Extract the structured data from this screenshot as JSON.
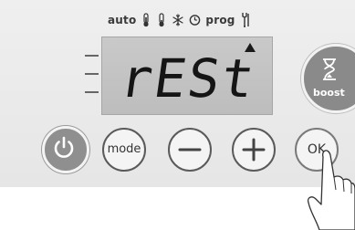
{
  "modes": {
    "auto_label": "auto",
    "prog_label": "prog",
    "icons": [
      "thermometer-comfort-icon",
      "thermometer-eco-icon",
      "snowflake-icon",
      "clock-icon",
      "wrench-icon"
    ]
  },
  "display": {
    "text": "rESt",
    "indicator": "triangle-up-icon",
    "level_bars": 3
  },
  "buttons": {
    "power_icon": "power-icon",
    "mode_label": "mode",
    "minus_icon": "minus-icon",
    "plus_icon": "plus-icon",
    "ok_label": "OK",
    "boost_label": "boost",
    "boost_icon": "hourglass-icon"
  },
  "colors": {
    "panel": "#e6e6e6",
    "lcd": "#c4c4c4",
    "lcd_text": "#151515",
    "power_button": "#8f8f8f",
    "boost_button": "#8a8a8a"
  }
}
